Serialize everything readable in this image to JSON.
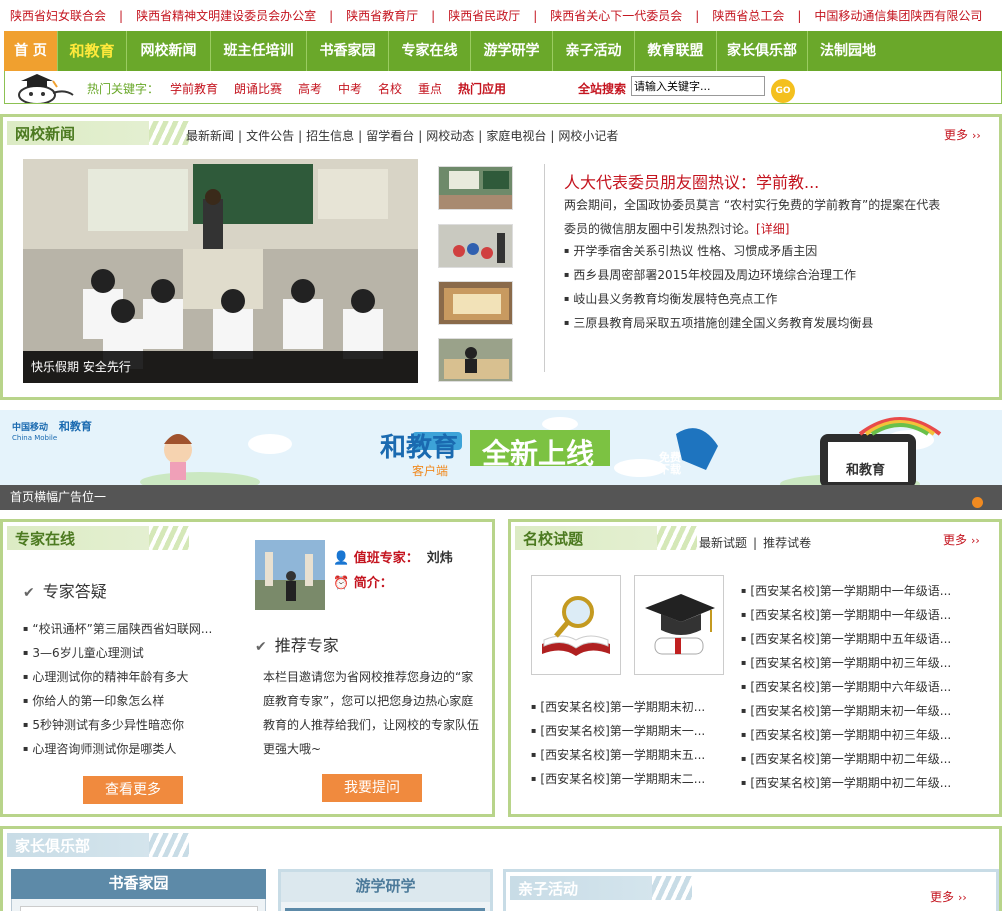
{
  "top_links": [
    "陕西省妇女联合会",
    "陕西省精神文明建设委员会办公室",
    "陕西省教育厅",
    "陕西省民政厅",
    "陕西省关心下一代委员会",
    "陕西省总工会",
    "中国移动通信集团陕西有限公司"
  ],
  "top_link_separator": "|",
  "nav": [
    "首 页",
    "和教育",
    "网校新闻",
    "班主任培训",
    "书香家园",
    "专家在线",
    "游学研学",
    "亲子活动",
    "教育联盟",
    "家长俱乐部",
    "法制园地"
  ],
  "search": {
    "hot_label": "热门关键字：",
    "keywords": [
      "学前教育",
      "朗诵比赛",
      "高考",
      "中考",
      "名校",
      "重点",
      "热门应用"
    ],
    "label": "全站搜索",
    "value": "请输入关键字...",
    "go": "GO"
  },
  "news": {
    "title": "网校新闻",
    "tabs": [
      "最新新闻",
      "文件公告",
      "招生信息",
      "留学看台",
      "网校动态",
      "家庭电视台",
      "网校小记者"
    ],
    "tab_separator": "|",
    "more": "更多",
    "caption": "快乐假期  安全先行",
    "headline": "人大代表委员朋友圈热议：学前教...",
    "summary": "两会期间，全国政协委员莫言 “农村实行免费的学前教育”的提案在代表委员的微信朋友圈中引发热烈讨论。",
    "detail": "[详细]",
    "items": [
      "开学季宿舍关系引热议 性格、习惯成矛盾主因",
      "西乡县周密部署2015年校园及周边环境综合治理工作",
      "岐山县义务教育均衡发展特色亮点工作",
      "三原县教育局采取五项措施创建全国义务教育发展均衡县"
    ]
  },
  "banner": {
    "brand1": "中国移动",
    "brand1_en": "China Mobile",
    "brand2": "和教育",
    "product": "和教育",
    "product_sub": "客户端",
    "tagline": "全新上线",
    "badge": "免费下载",
    "phone_label": "和教育",
    "bar_text": "首页横幅广告位一"
  },
  "expert": {
    "title": "专家在线",
    "qa_head": "专家答疑",
    "qa_items": [
      "“校讯通杯”第三届陕西省妇联网...",
      "3—6岁儿童心理测试",
      "心理测试你的精神年龄有多大",
      "你给人的第一印象怎么样",
      "5秒钟测试有多少异性暗恋你",
      "心理咨询师测试你是哪类人"
    ],
    "duty_label": "值班专家：",
    "duty_name": "刘炜",
    "intro_label": "简介：",
    "rec_head": "推荐专家",
    "rec_text": "本栏目邀请您为省网校推荐您身边的“家庭教育专家”，您可以把您身边热心家庭教育的人推荐给我们，让网校的专家队伍更强大哦~",
    "more_btn": "查看更多",
    "ask_btn": "我要提问"
  },
  "schools": {
    "title": "名校试题",
    "tabs": [
      "最新试题",
      "推荐试卷"
    ],
    "tab_separator": "|",
    "more": "更多",
    "left_items": [
      "[西安某名校]第一学期期末初...",
      "[西安某名校]第一学期期末一...",
      "[西安某名校]第一学期期末五...",
      "[西安某名校]第一学期期末二..."
    ],
    "right_items": [
      "[西安某名校]第一学期期中一年级语...",
      "[西安某名校]第一学期期中一年级语...",
      "[西安某名校]第一学期期中五年级语...",
      "[西安某名校]第一学期期中初三年级...",
      "[西安某名校]第一学期期中六年级语...",
      "[西安某名校]第一学期期末初一年级...",
      "[西安某名校]第一学期期中初三年级...",
      "[西安某名校]第一学期期中初二年级...",
      "[西安某名校]第一学期期中初二年级..."
    ]
  },
  "club": {
    "title": "家长俱乐部",
    "sub1": "书香家园",
    "sub2": "游学研学",
    "sub3": "亲子活动",
    "more": "更多"
  }
}
